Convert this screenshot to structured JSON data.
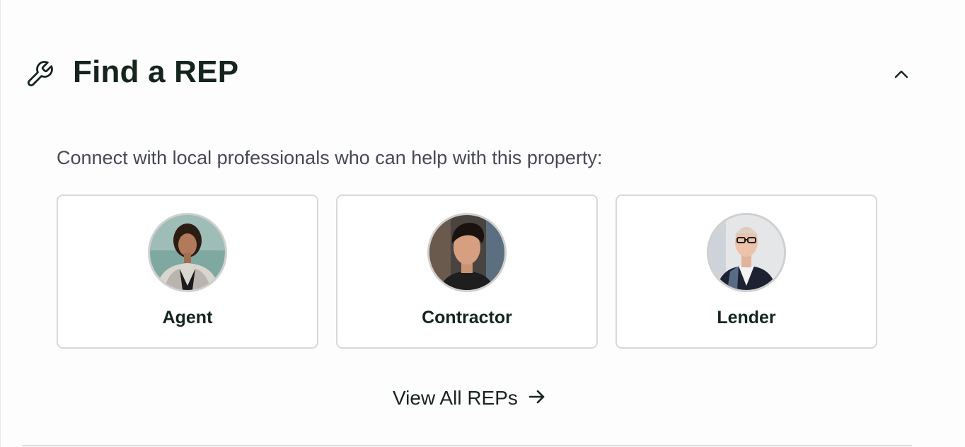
{
  "section": {
    "title": "Find a REP",
    "icon": "wrench-icon",
    "collapse_icon": "chevron-up-icon"
  },
  "subtitle": "Connect with local professionals who can help with this property:",
  "cards": [
    {
      "label": "Agent",
      "icon": "agent-avatar"
    },
    {
      "label": "Contractor",
      "icon": "contractor-avatar"
    },
    {
      "label": "Lender",
      "icon": "lender-avatar"
    }
  ],
  "view_all": {
    "label": "View All REPs",
    "icon": "arrow-right-icon"
  },
  "colors": {
    "text_dark": "#15251d",
    "text_muted": "#474a54",
    "card_border": "#d8d8d8"
  }
}
